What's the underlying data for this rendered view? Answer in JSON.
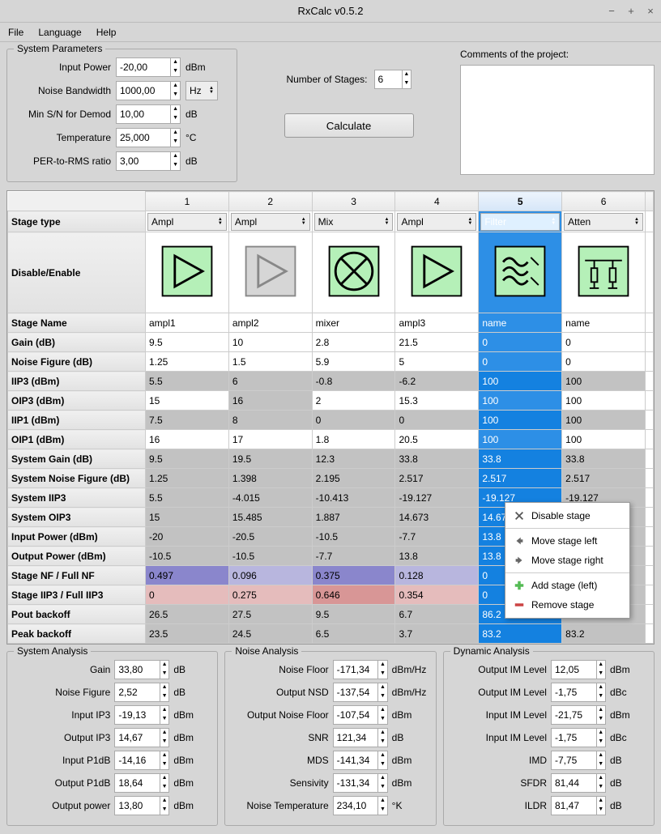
{
  "window": {
    "title": "RxCalc v0.5.2"
  },
  "menu": {
    "file": "File",
    "language": "Language",
    "help": "Help"
  },
  "sysparams": {
    "legend": "System Parameters",
    "input_power": {
      "label": "Input Power",
      "value": "-20,00",
      "unit": "dBm"
    },
    "noise_bw": {
      "label": "Noise Bandwidth",
      "value": "1000,00",
      "unit": "Hz"
    },
    "min_sn": {
      "label": "Min S/N for Demod",
      "value": "10,00",
      "unit": "dB"
    },
    "temperature": {
      "label": "Temperature",
      "value": "25,000",
      "unit": "°C"
    },
    "per_rms": {
      "label": "PER-to-RMS ratio",
      "value": "3,00",
      "unit": "dB"
    }
  },
  "numstages": {
    "label": "Number of Stages:",
    "value": "6"
  },
  "calc_label": "Calculate",
  "comments_label": "Comments of the project:",
  "col_headers": [
    "1",
    "2",
    "3",
    "4",
    "5",
    "6"
  ],
  "row_headers": {
    "stage_type": "Stage type",
    "disable_enable": "Disable/Enable",
    "stage_name": "Stage Name",
    "gain": "Gain (dB)",
    "nf": "Noise Figure (dB)",
    "iip3": "IIP3 (dBm)",
    "oip3": "OIP3 (dBm)",
    "iip1": "IIP1 (dBm)",
    "oip1": "OIP1 (dBm)",
    "sys_gain": "System Gain (dB)",
    "sys_nf": "System Noise Figure (dB)",
    "sys_iip3": "System IIP3",
    "sys_oip3": "System OIP3",
    "in_pow": "Input Power (dBm)",
    "out_pow": "Output Power (dBm)",
    "stage_nf": "Stage NF / Full NF",
    "stage_iip3": "Stage IIP3 / Full IIP3",
    "pout_bo": "Pout backoff",
    "peak_bo": "Peak backoff"
  },
  "stage_types": [
    "Ampl",
    "Ampl",
    "Mix",
    "Ampl",
    "Filter",
    "Atten"
  ],
  "stage_names": [
    "ampl1",
    "ampl2",
    "mixer",
    "ampl3",
    "name",
    "name"
  ],
  "gain": [
    "9.5",
    "10",
    "2.8",
    "21.5",
    "0",
    "0"
  ],
  "nf": [
    "1.25",
    "1.5",
    "5.9",
    "5",
    "0",
    "0"
  ],
  "iip3": [
    "5.5",
    "6",
    "-0.8",
    "-6.2",
    "100",
    "100"
  ],
  "oip3": [
    "15",
    "16",
    "2",
    "15.3",
    "100",
    "100"
  ],
  "iip1": [
    "7.5",
    "8",
    "0",
    "0",
    "100",
    "100"
  ],
  "oip1": [
    "16",
    "17",
    "1.8",
    "20.5",
    "100",
    "100"
  ],
  "sys_gain": [
    "9.5",
    "19.5",
    "12.3",
    "33.8",
    "33.8",
    "33.8"
  ],
  "sys_nf": [
    "1.25",
    "1.398",
    "2.195",
    "2.517",
    "2.517",
    "2.517"
  ],
  "sys_iip3": [
    "5.5",
    "-4.015",
    "-10.413",
    "-19.127",
    "-19.127",
    "-19.127"
  ],
  "sys_oip3": [
    "15",
    "15.485",
    "1.887",
    "14.673",
    "14.673",
    ""
  ],
  "in_pow": [
    "-20",
    "-20.5",
    "-10.5",
    "-7.7",
    "13.8",
    ""
  ],
  "out_pow": [
    "-10.5",
    "-10.5",
    "-7.7",
    "13.8",
    "13.8",
    ""
  ],
  "stage_nf": [
    "0.497",
    "0.096",
    "0.375",
    "0.128",
    "0",
    ""
  ],
  "stage_iip3": [
    "0",
    "0.275",
    "0.646",
    "0.354",
    "0",
    ""
  ],
  "pout_bo": [
    "26.5",
    "27.5",
    "9.5",
    "6.7",
    "86.2",
    ""
  ],
  "peak_bo": [
    "23.5",
    "24.5",
    "6.5",
    "3.7",
    "83.2",
    "83.2"
  ],
  "ctx": {
    "disable": "Disable stage",
    "move_left": "Move stage left",
    "move_right": "Move stage right",
    "add": "Add stage (left)",
    "remove": "Remove stage"
  },
  "sys_analysis": {
    "legend": "System Analysis",
    "gain": {
      "label": "Gain",
      "value": "33,80",
      "unit": "dB"
    },
    "nf": {
      "label": "Noise Figure",
      "value": "2,52",
      "unit": "dB"
    },
    "iip3": {
      "label": "Input IP3",
      "value": "-19,13",
      "unit": "dBm"
    },
    "oip3": {
      "label": "Output IP3",
      "value": "14,67",
      "unit": "dBm"
    },
    "ip1db": {
      "label": "Input P1dB",
      "value": "-14,16",
      "unit": "dBm"
    },
    "op1db": {
      "label": "Output P1dB",
      "value": "18,64",
      "unit": "dBm"
    },
    "outpow": {
      "label": "Output power",
      "value": "13,80",
      "unit": "dBm"
    }
  },
  "noise_analysis": {
    "legend": "Noise Analysis",
    "floor": {
      "label": "Noise Floor",
      "value": "-171,34",
      "unit": "dBm/Hz"
    },
    "onsd": {
      "label": "Output NSD",
      "value": "-137,54",
      "unit": "dBm/Hz"
    },
    "onf": {
      "label": "Output Noise Floor",
      "value": "-107,54",
      "unit": "dBm"
    },
    "snr": {
      "label": "SNR",
      "value": "121,34",
      "unit": "dB"
    },
    "mds": {
      "label": "MDS",
      "value": "-141,34",
      "unit": "dBm"
    },
    "sens": {
      "label": "Sensivity",
      "value": "-131,34",
      "unit": "dBm"
    },
    "ntemp": {
      "label": "Noise Temperature",
      "value": "234,10",
      "unit": "°K"
    }
  },
  "dyn_analysis": {
    "legend": "Dynamic Analysis",
    "oim_dbm": {
      "label": "Output IM Level",
      "value": "12,05",
      "unit": "dBm"
    },
    "oim_dbc": {
      "label": "Output IM Level",
      "value": "-1,75",
      "unit": "dBc"
    },
    "iim_dbm": {
      "label": "Input IM Level",
      "value": "-21,75",
      "unit": "dBm"
    },
    "iim_dbc": {
      "label": "Input IM Level",
      "value": "-1,75",
      "unit": "dBc"
    },
    "imd": {
      "label": "IMD",
      "value": "-7,75",
      "unit": "dB"
    },
    "sfdr": {
      "label": "SFDR",
      "value": "81,44",
      "unit": "dB"
    },
    "ildr": {
      "label": "ILDR",
      "value": "81,47",
      "unit": "dB"
    }
  }
}
